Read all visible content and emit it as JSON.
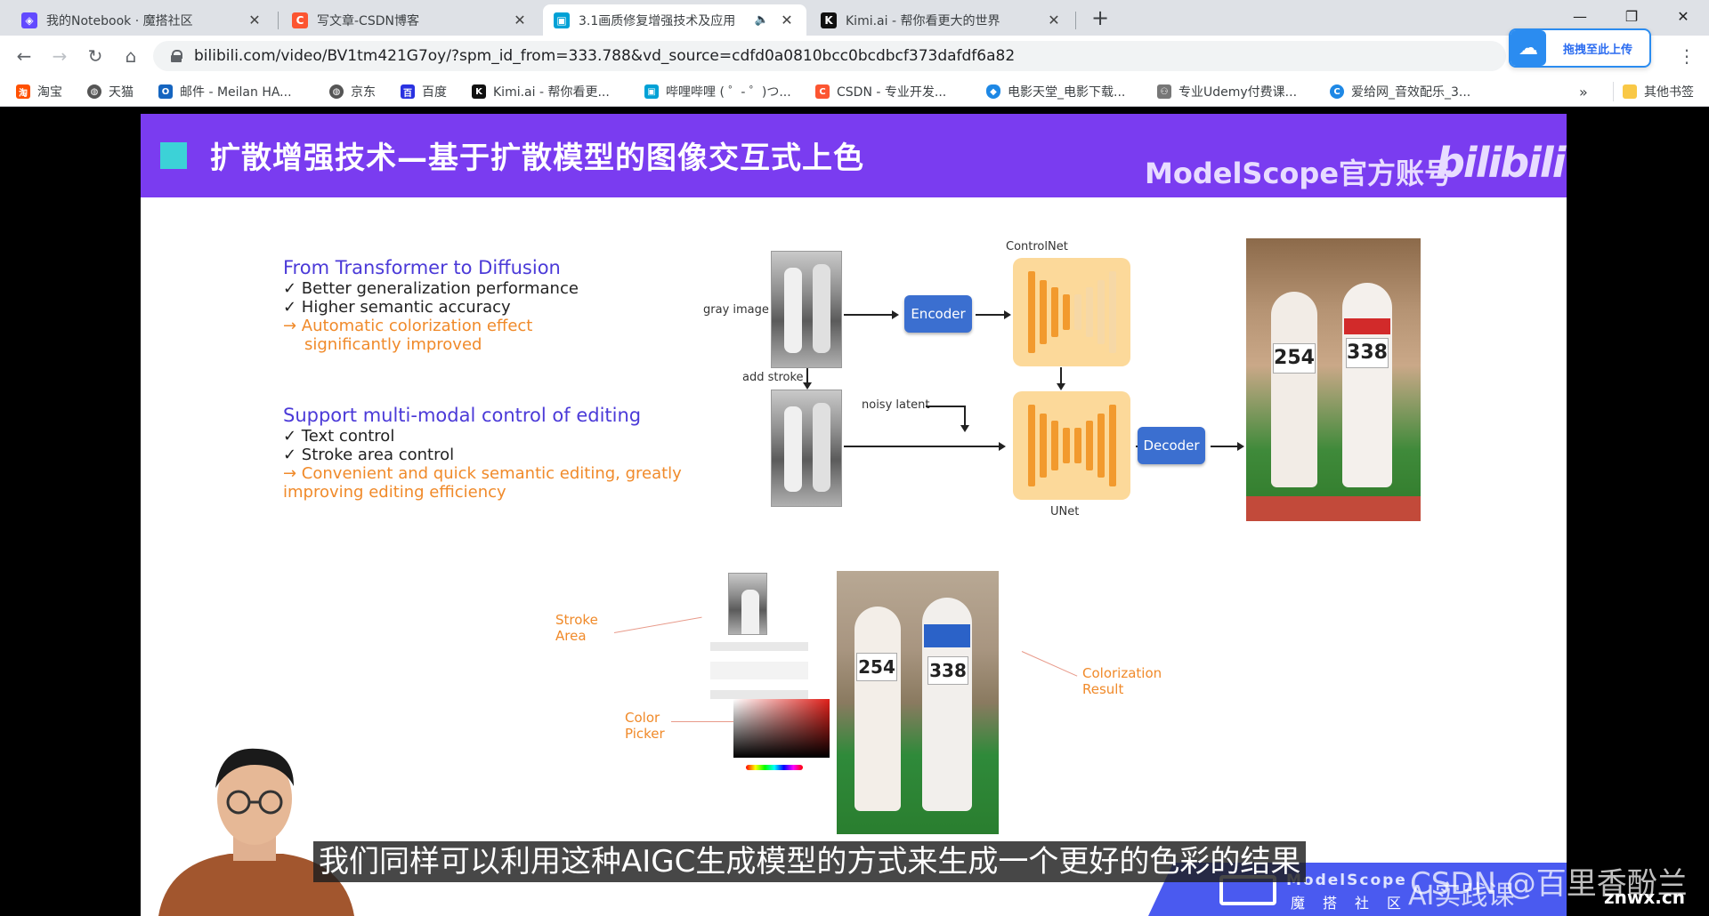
{
  "tabs": [
    {
      "title": "我的Notebook · 魔搭社区",
      "favicon": "modelscope-icon",
      "color": "#624aff"
    },
    {
      "title": "写文章-CSDN博客",
      "favicon": "csdn-icon",
      "color": "#fc5531"
    },
    {
      "title": "3.1画质修复增强技术及应用",
      "favicon": "bilibili-icon",
      "color": "#00a1d6",
      "active": true
    },
    {
      "title": "Kimi.ai - 帮你看更大的世界",
      "favicon": "kimi-icon",
      "color": "#111111"
    }
  ],
  "window": {
    "new_tab": "+",
    "minimize": "—",
    "restore": "❐",
    "close": "✕"
  },
  "address": {
    "url": "bilibili.com/video/BV1tm421G7oy/?spm_id_from=333.788&vd_source=cdfd0a0810bcc0bcdbcf373dafdf6a82"
  },
  "upload_button": {
    "label": "拖拽至此上传"
  },
  "bookmarks": [
    {
      "label": "淘宝",
      "color": "#ff5000",
      "icon": "taobao-icon"
    },
    {
      "label": "天猫",
      "color": "#555555",
      "icon": "globe-icon"
    },
    {
      "label": "邮件 - Meilan HA...",
      "color": "#1565c0",
      "icon": "outlook-icon"
    },
    {
      "label": "京东",
      "color": "#555555",
      "icon": "globe-icon"
    },
    {
      "label": "百度",
      "color": "#2932e1",
      "icon": "baidu-icon"
    },
    {
      "label": "Kimi.ai - 帮你看更...",
      "color": "#111111",
      "icon": "kimi-icon"
    },
    {
      "label": "哔哩哔哩 ( ゜- ゜)つ...",
      "color": "#00a1d6",
      "icon": "bilibili-icon"
    },
    {
      "label": "CSDN - 专业开发...",
      "color": "#fc5531",
      "icon": "csdn-icon"
    },
    {
      "label": "电影天堂_电影下载...",
      "color": "#1e88e5",
      "icon": "shield-icon"
    },
    {
      "label": "专业Udemy付费课...",
      "color": "#777777",
      "icon": "people-icon"
    },
    {
      "label": "爱给网_音效配乐_3...",
      "color": "#1e88e5",
      "icon": "aigei-icon"
    }
  ],
  "bookmarks_more": "»",
  "other_bookmarks": "其他书签",
  "slide": {
    "title": "扩散增强技术—基于扩散模型的图像交互式上色",
    "brand": "ModelScope官方账号",
    "brand_logo": "bilibili",
    "section1": {
      "heading": "From Transformer to Diffusion",
      "items": [
        "✓ Better generalization performance",
        "✓ Higher semantic accuracy"
      ],
      "highlight": [
        "→ Automatic colorization effect",
        "significantly improved"
      ]
    },
    "section2": {
      "heading": "Support multi-modal control of editing",
      "items": [
        "✓ Text control",
        "✓ Stroke area control"
      ],
      "highlight": [
        "→ Convenient and quick semantic editing, greatly",
        "improving editing efficiency"
      ]
    },
    "diagram": {
      "gray_image": "gray image",
      "add_stroke": "add stroke",
      "noisy_latent": "noisy latent",
      "encoder": "Encoder",
      "decoder": "Decoder",
      "controlnet": "ControlNet",
      "unet": "UNet"
    },
    "demo": {
      "stroke_area": [
        "Stroke",
        "Area"
      ],
      "color_picker": [
        "Color",
        "Picker"
      ],
      "colorization_result": [
        "Colorization",
        "Result"
      ]
    },
    "bibs": {
      "left": "254",
      "right": "338"
    }
  },
  "subtitle": "我们同样可以利用这种AIGC生成模型的方式来生成一个更好的色彩的结果",
  "banner": {
    "name": "ModelScope",
    "cn": "魔搭社区"
  },
  "watermark": "CSDN @百里香酚兰",
  "watermark2": "AI实践课",
  "site_mark": "znwx.cn"
}
